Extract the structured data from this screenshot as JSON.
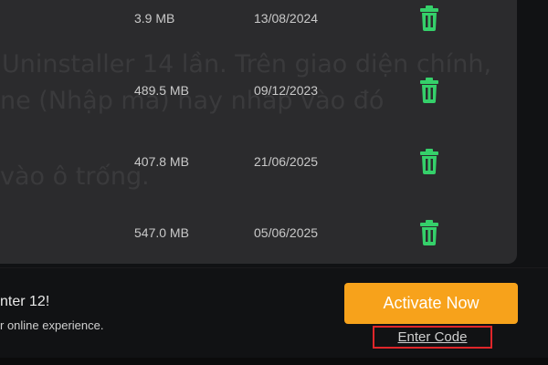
{
  "background_text": {
    "line1": "Uninstaller 14 lần. Trên giao diện chính,",
    "line2": "ne (Nhập mã) hay nhấp vào đó",
    "line3": "vào ô trống."
  },
  "apps": [
    {
      "size": "3.9 MB",
      "date": "13/08/2024",
      "action_icon": "trash-icon"
    },
    {
      "size": "489.5 MB",
      "date": "09/12/2023",
      "action_icon": "trash-icon"
    },
    {
      "size": "407.8 MB",
      "date": "21/06/2025",
      "action_icon": "trash-icon"
    },
    {
      "size": "547.0 MB",
      "date": "05/06/2025",
      "action_icon": "trash-icon"
    }
  ],
  "promo": {
    "title": "nter 12!",
    "subtitle": "r online experience."
  },
  "activate_label": "Activate Now",
  "enter_code_label": "Enter Code",
  "colors": {
    "accent": "#f7a21b",
    "trash": "#35d06a",
    "highlight": "#e0262a",
    "panel": "#2b2b2d"
  }
}
